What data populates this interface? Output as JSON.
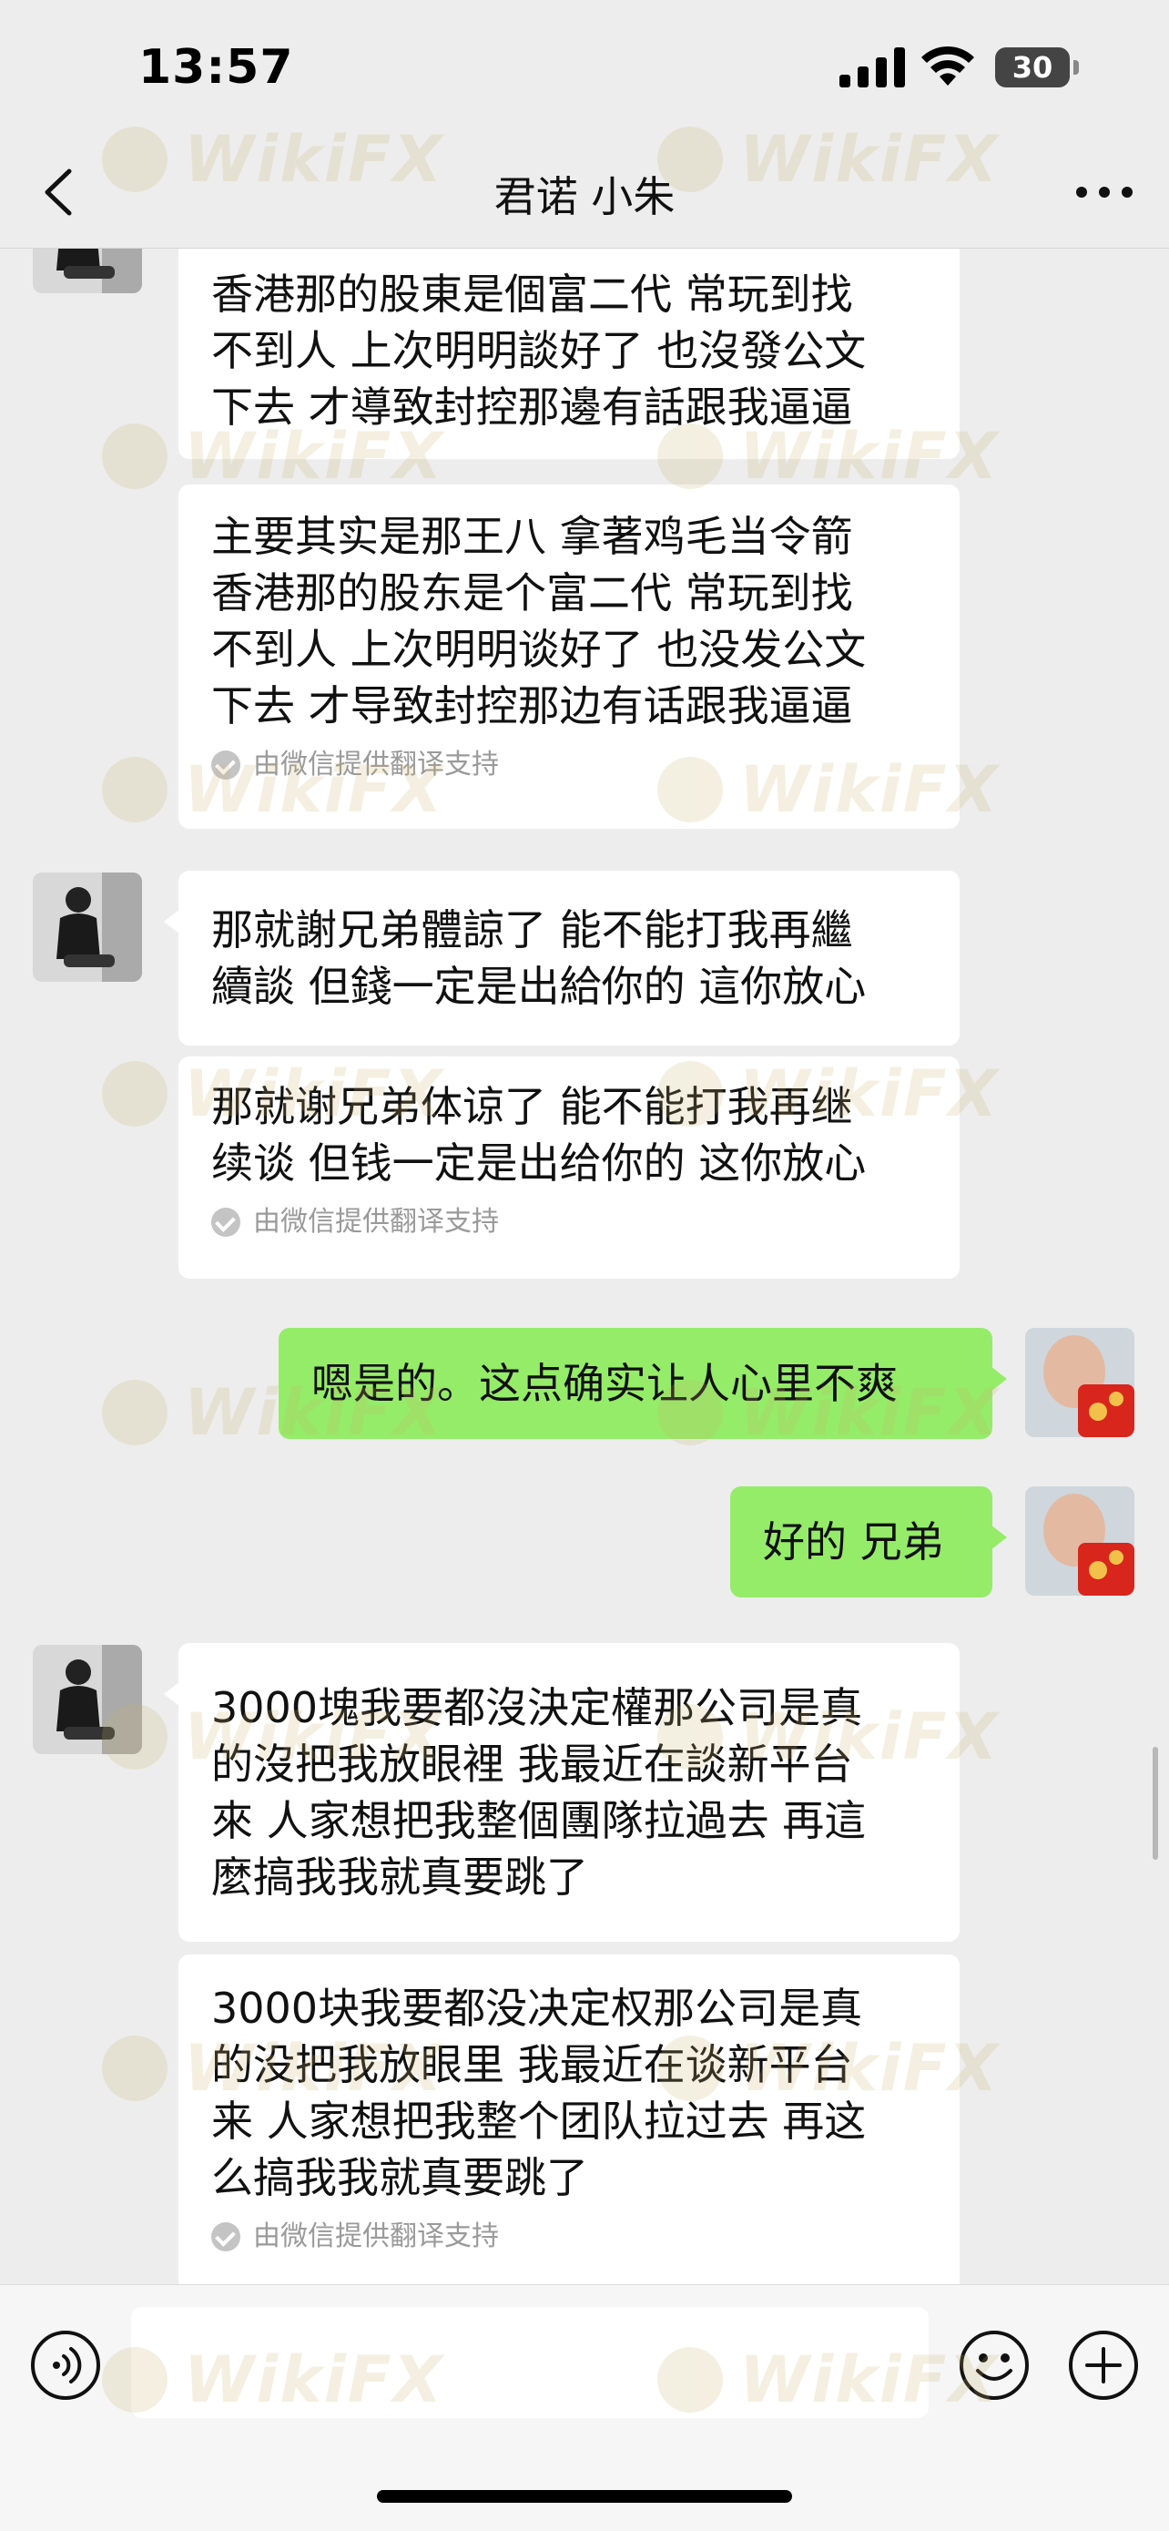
{
  "status_bar": {
    "time": "13:57",
    "battery": "30"
  },
  "header": {
    "title": "君诺 小朱"
  },
  "watermark": "WikiFX",
  "messages": [
    {
      "side": "in",
      "text": "香港那的股東是個富二代 常玩到找\n不到人 上次明明談好了 也沒發公文\n下去 才導致封控那邊有話跟我逼逼"
    },
    {
      "side": "in",
      "text": "主要其实是那王八 拿著鸡毛当令箭\n香港那的股东是个富二代 常玩到找\n不到人 上次明明谈好了 也没发公文\n下去 才导致封控那边有话跟我逼逼",
      "note": "由微信提供翻译支持"
    },
    {
      "side": "in",
      "text": "那就謝兄弟體諒了 能不能打我再繼\n續談 但錢一定是出給你的 這你放心"
    },
    {
      "side": "in",
      "text": "那就谢兄弟体谅了 能不能打我再继\n续谈 但钱一定是出给你的 这你放心",
      "note": "由微信提供翻译支持"
    },
    {
      "side": "out",
      "text": "嗯是的。这点确实让人心里不爽"
    },
    {
      "side": "out",
      "text": "好的 兄弟"
    },
    {
      "side": "in",
      "text": "3000塊我要都沒決定權那公司是真\n的沒把我放眼裡 我最近在談新平台\n來 人家想把我整個團隊拉過去 再這\n麼搞我我就真要跳了"
    },
    {
      "side": "in",
      "text": "3000块我要都没决定权那公司是真\n的没把我放眼里 我最近在谈新平台\n来 人家想把我整个团队拉过去 再这\n么搞我我就真要跳了",
      "note": "由微信提供翻译支持"
    }
  ],
  "input": {
    "placeholder": ""
  },
  "colors": {
    "background": "#ededed",
    "incoming_bubble": "#ffffff",
    "outgoing_bubble": "#95ec69",
    "note_text": "#9a9a9a"
  },
  "icons": {
    "back": "chevron-left-icon",
    "more": "more-dots-icon",
    "voice": "voice-icon",
    "emoji": "emoji-icon",
    "plus": "plus-icon",
    "translate_check": "check-circle-icon"
  }
}
